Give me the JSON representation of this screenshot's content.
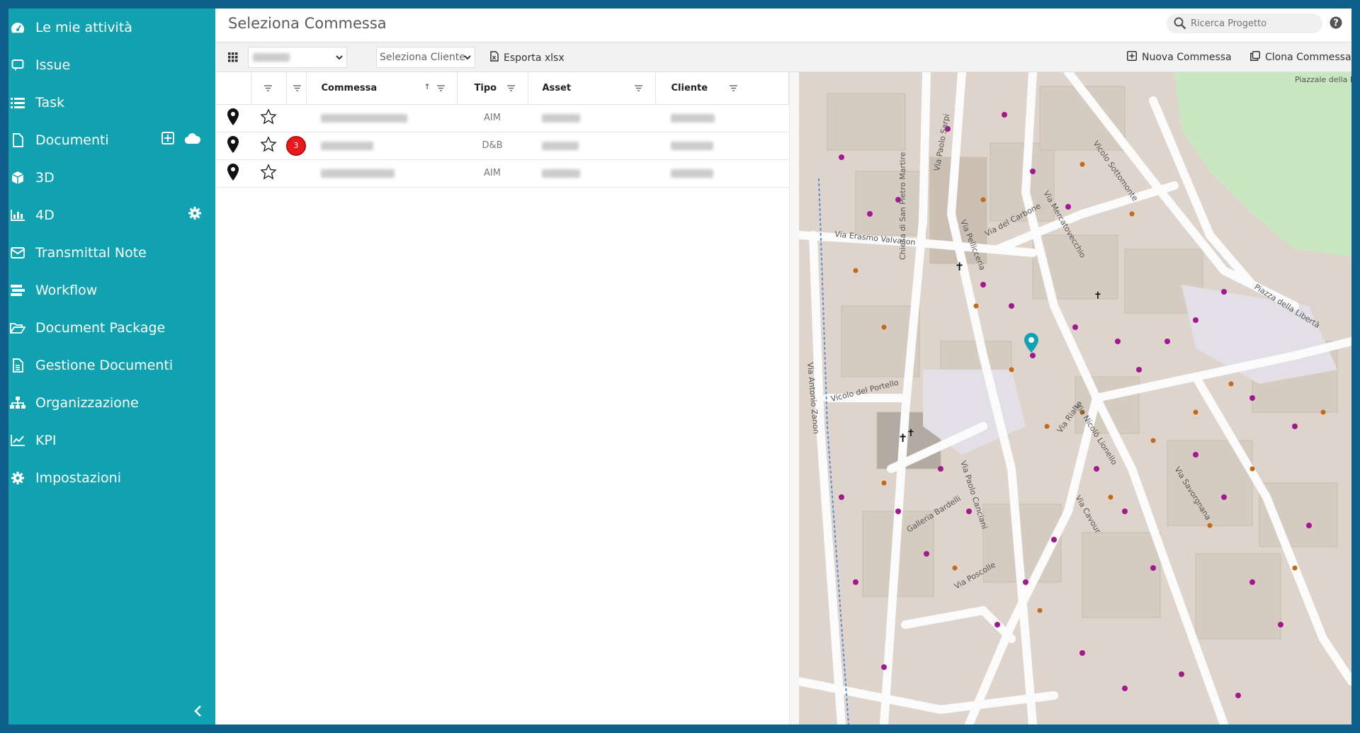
{
  "sidebar": {
    "items": [
      {
        "label": "Le mie attività",
        "icon": "dashboard-icon"
      },
      {
        "label": "Issue",
        "icon": "comment-icon"
      },
      {
        "label": "Task",
        "icon": "list-icon"
      },
      {
        "label": "Documenti",
        "icon": "document-icon"
      },
      {
        "label": "3D",
        "icon": "cube-icon"
      },
      {
        "label": "4D",
        "icon": "bar-chart-icon"
      },
      {
        "label": "Transmittal Note",
        "icon": "envelope-icon"
      },
      {
        "label": "Workflow",
        "icon": "workflow-icon"
      },
      {
        "label": "Document Package",
        "icon": "folder-open-icon"
      },
      {
        "label": "Gestione Documenti",
        "icon": "file-text-icon"
      },
      {
        "label": "Organizzazione",
        "icon": "sitemap-icon"
      },
      {
        "label": "KPI",
        "icon": "line-chart-icon"
      },
      {
        "label": "Impostazioni",
        "icon": "gear-icon"
      }
    ]
  },
  "header": {
    "title": "Seleziona Commessa",
    "search_placeholder": "Ricerca Progetto"
  },
  "toolbar": {
    "client_select_placeholder": "Seleziona Cliente",
    "export_label": "Esporta xlsx",
    "new_label": "Nuova Commessa",
    "clone_label": "Clona Commessa"
  },
  "table": {
    "columns": [
      "Commessa",
      "Tipo",
      "Asset",
      "Cliente"
    ],
    "rows": [
      {
        "tipo": "AIM",
        "badge": ""
      },
      {
        "tipo": "D&B",
        "badge": "3"
      },
      {
        "tipo": "AIM",
        "badge": ""
      }
    ]
  },
  "map": {
    "labels": {
      "via_erasmo_valvason": "Via Erasmo Valvason",
      "via_paolo_sarpi": "Via Paolo Sarpi",
      "via_pellicceria": "Via Pellicceria",
      "via_del_carbone": "Via del Carbone",
      "via_mercatovecchio": "Via Mercatovecchio",
      "vicolo_sottomonte": "Vicolo Sottomonte",
      "piazza_della_liberta": "Piazza della Libertà",
      "via_antonio_zanon": "Via Antonio Zanon",
      "vicolo_del_portello": "Vicolo del Portello",
      "via_paolo_canciani": "Via Paolo Canciani",
      "galleria_bardelli": "Galleria Bardelli",
      "via_rialto": "Via Rialto",
      "via_nicolo_lionello": "Via Nicolò Lionello",
      "via_cavour": "Via Cavour",
      "via_savorgnana": "Via Savorgnana",
      "via_poscolle": "Via Poscolle",
      "piazzale_castello": "Piazzale della Patria del Friuli",
      "chiesa": "Chiesa di San Pietro Martire"
    }
  }
}
